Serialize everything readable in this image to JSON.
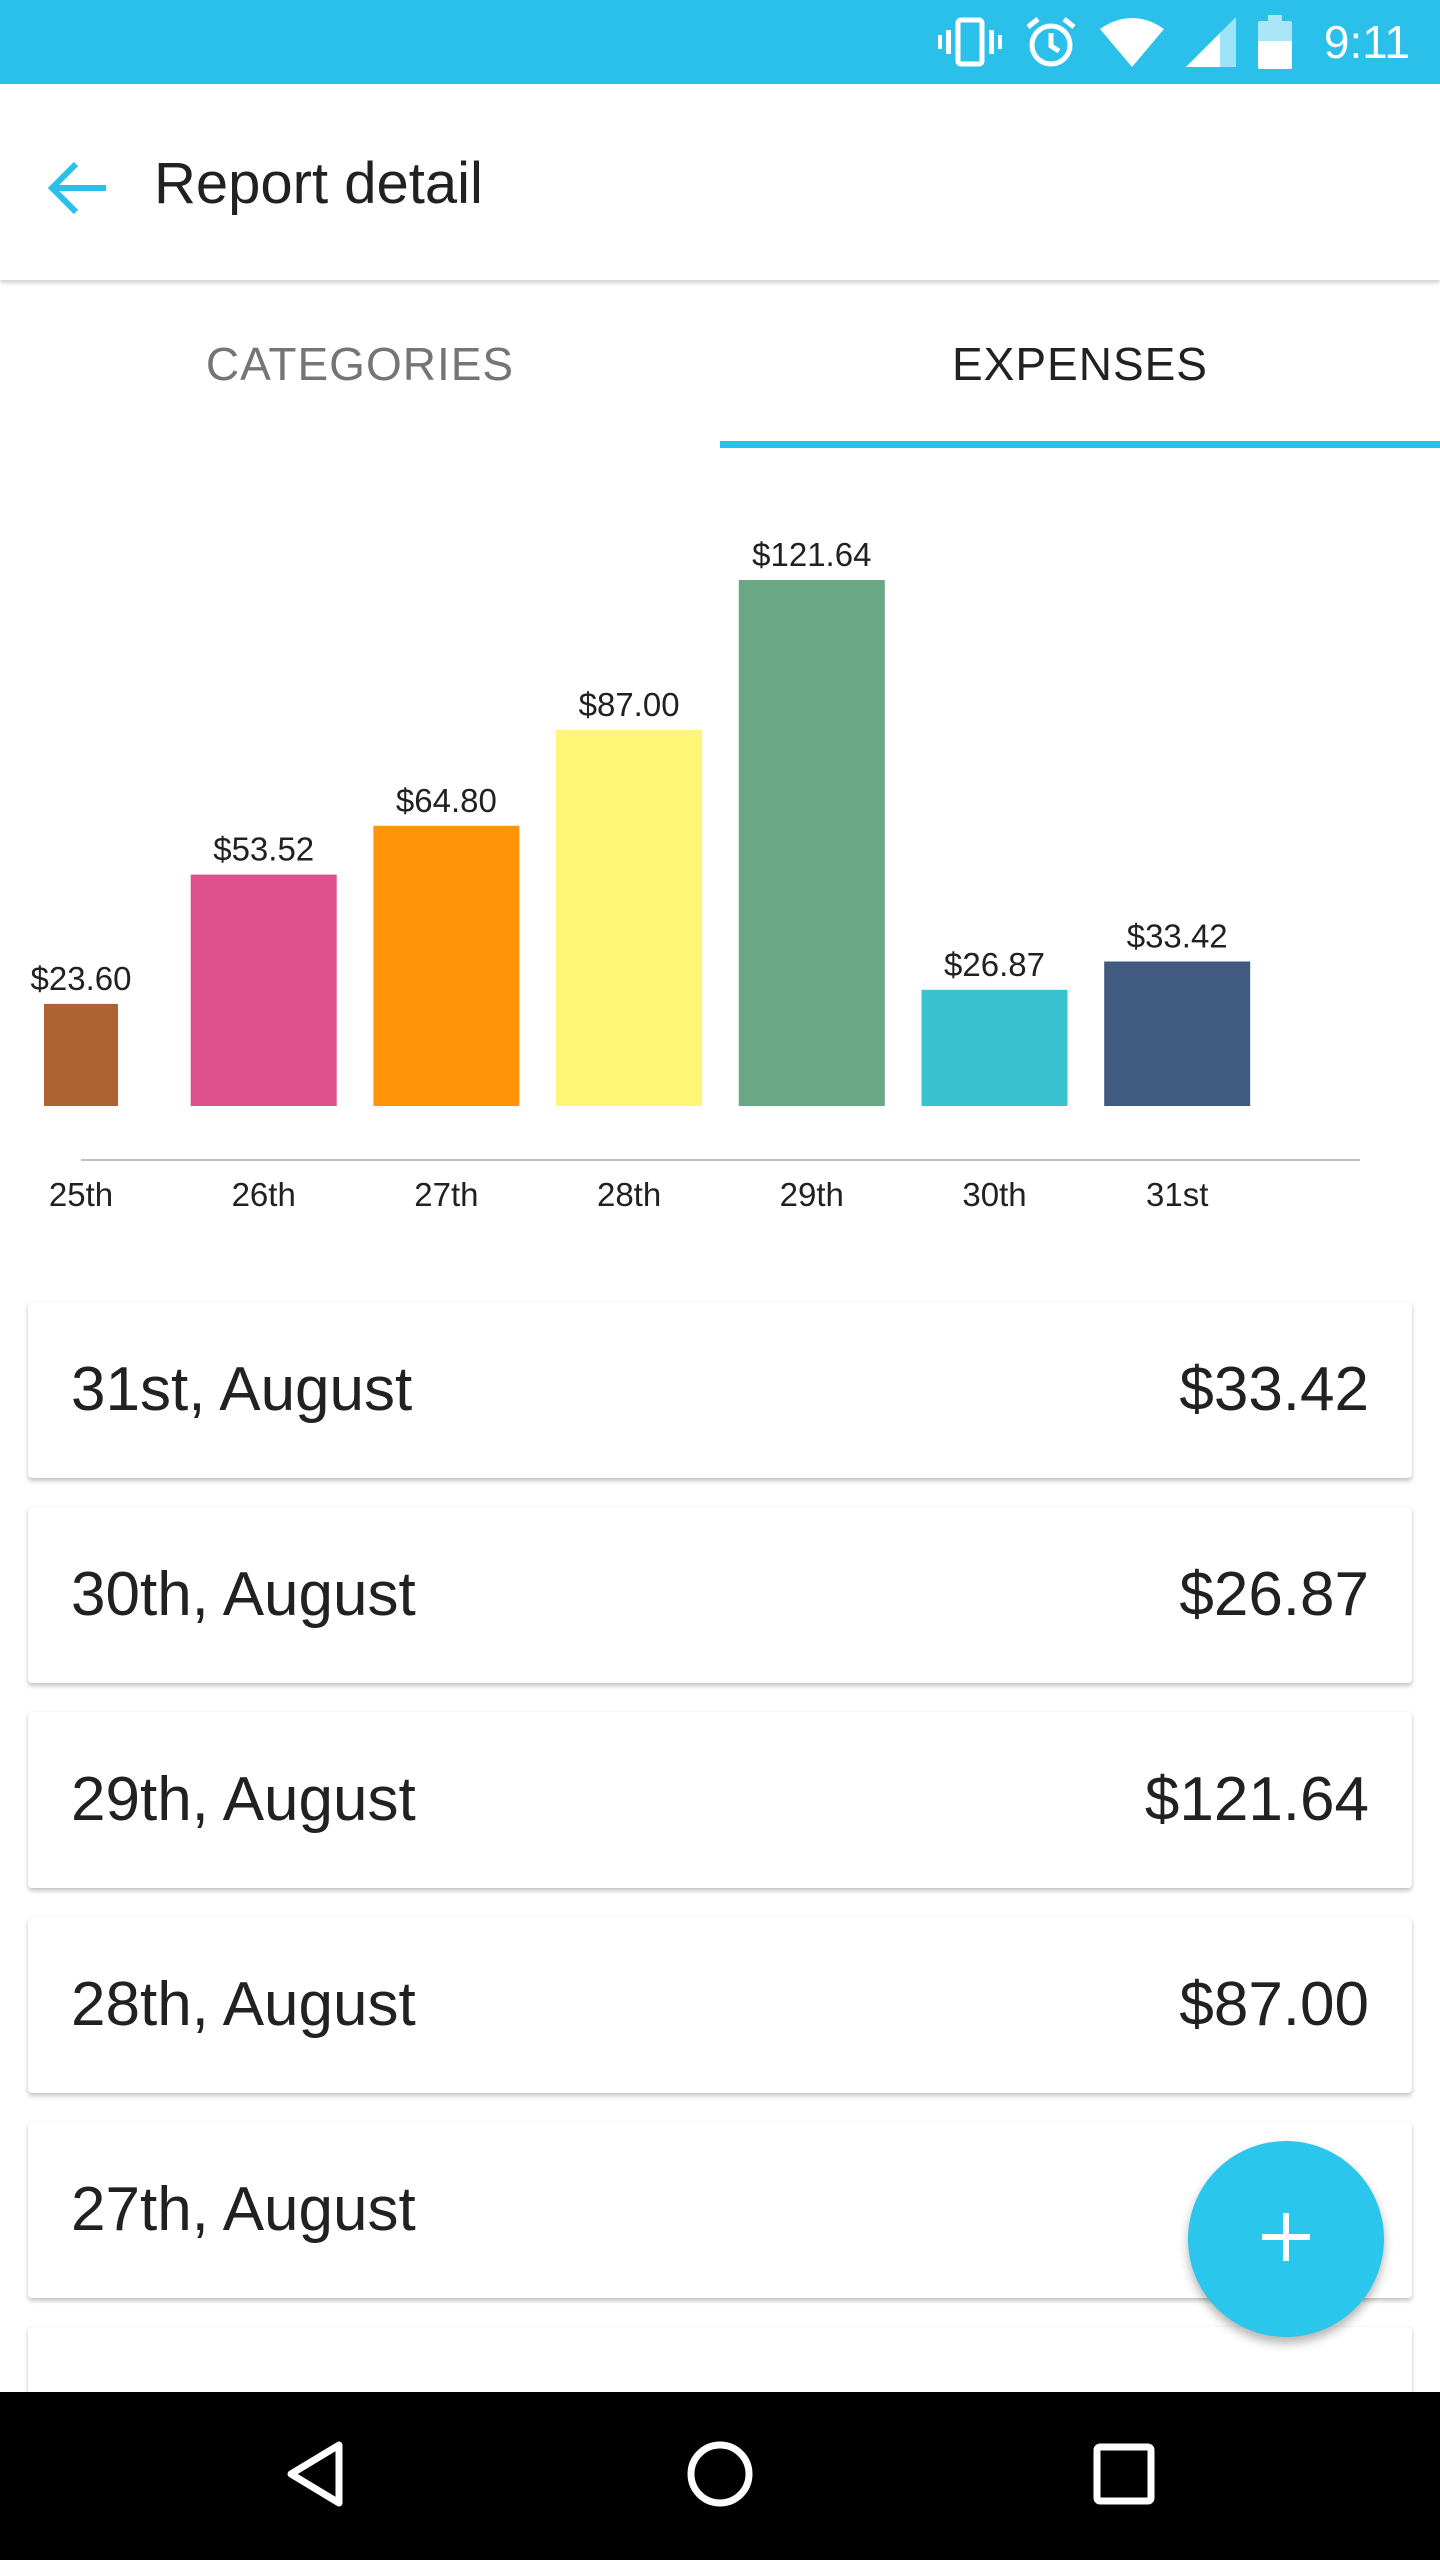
{
  "status_bar": {
    "time": "9:11",
    "icons": [
      "vibrate-icon",
      "alarm-icon",
      "wifi-icon",
      "signal-icon",
      "battery-icon"
    ]
  },
  "app_bar": {
    "title": "Report detail",
    "back_icon": "arrow-back-icon"
  },
  "tabs": [
    {
      "label": "CATEGORIES",
      "selected": false
    },
    {
      "label": "EXPENSES",
      "selected": true
    }
  ],
  "chart_data": {
    "type": "bar",
    "categories": [
      "25th",
      "26th",
      "27th",
      "28th",
      "29th",
      "30th",
      "31st"
    ],
    "values": [
      23.6,
      53.52,
      64.8,
      87.0,
      121.64,
      26.87,
      33.42
    ],
    "value_labels": [
      "$23.60",
      "$53.52",
      "$64.80",
      "$87.00",
      "$121.64",
      "$26.87",
      "$33.42"
    ],
    "colors": [
      "#b06332",
      "#dc5189",
      "#ff9408",
      "#fff677",
      "#6aa885",
      "#39c3d1",
      "#405a80"
    ],
    "title": "",
    "xlabel": "",
    "ylabel": "",
    "ylim": [
      0,
      121.64
    ],
    "grid": false,
    "legend": "none"
  },
  "expenses": [
    {
      "date": "31st, August",
      "amount": "$33.42"
    },
    {
      "date": "30th, August",
      "amount": "$26.87"
    },
    {
      "date": "29th, August",
      "amount": "$121.64"
    },
    {
      "date": "28th, August",
      "amount": "$87.00"
    },
    {
      "date": "27th, August",
      "amount": "$"
    },
    {
      "date": "",
      "amount": ""
    }
  ],
  "fab": {
    "icon": "plus-icon"
  },
  "nav_bar": {
    "icons": [
      "back-triangle-icon",
      "home-circle-icon",
      "recents-square-icon"
    ]
  },
  "colors": {
    "accent": "#2bc0ea",
    "text_primary": "#212121",
    "text_secondary": "#757575"
  }
}
